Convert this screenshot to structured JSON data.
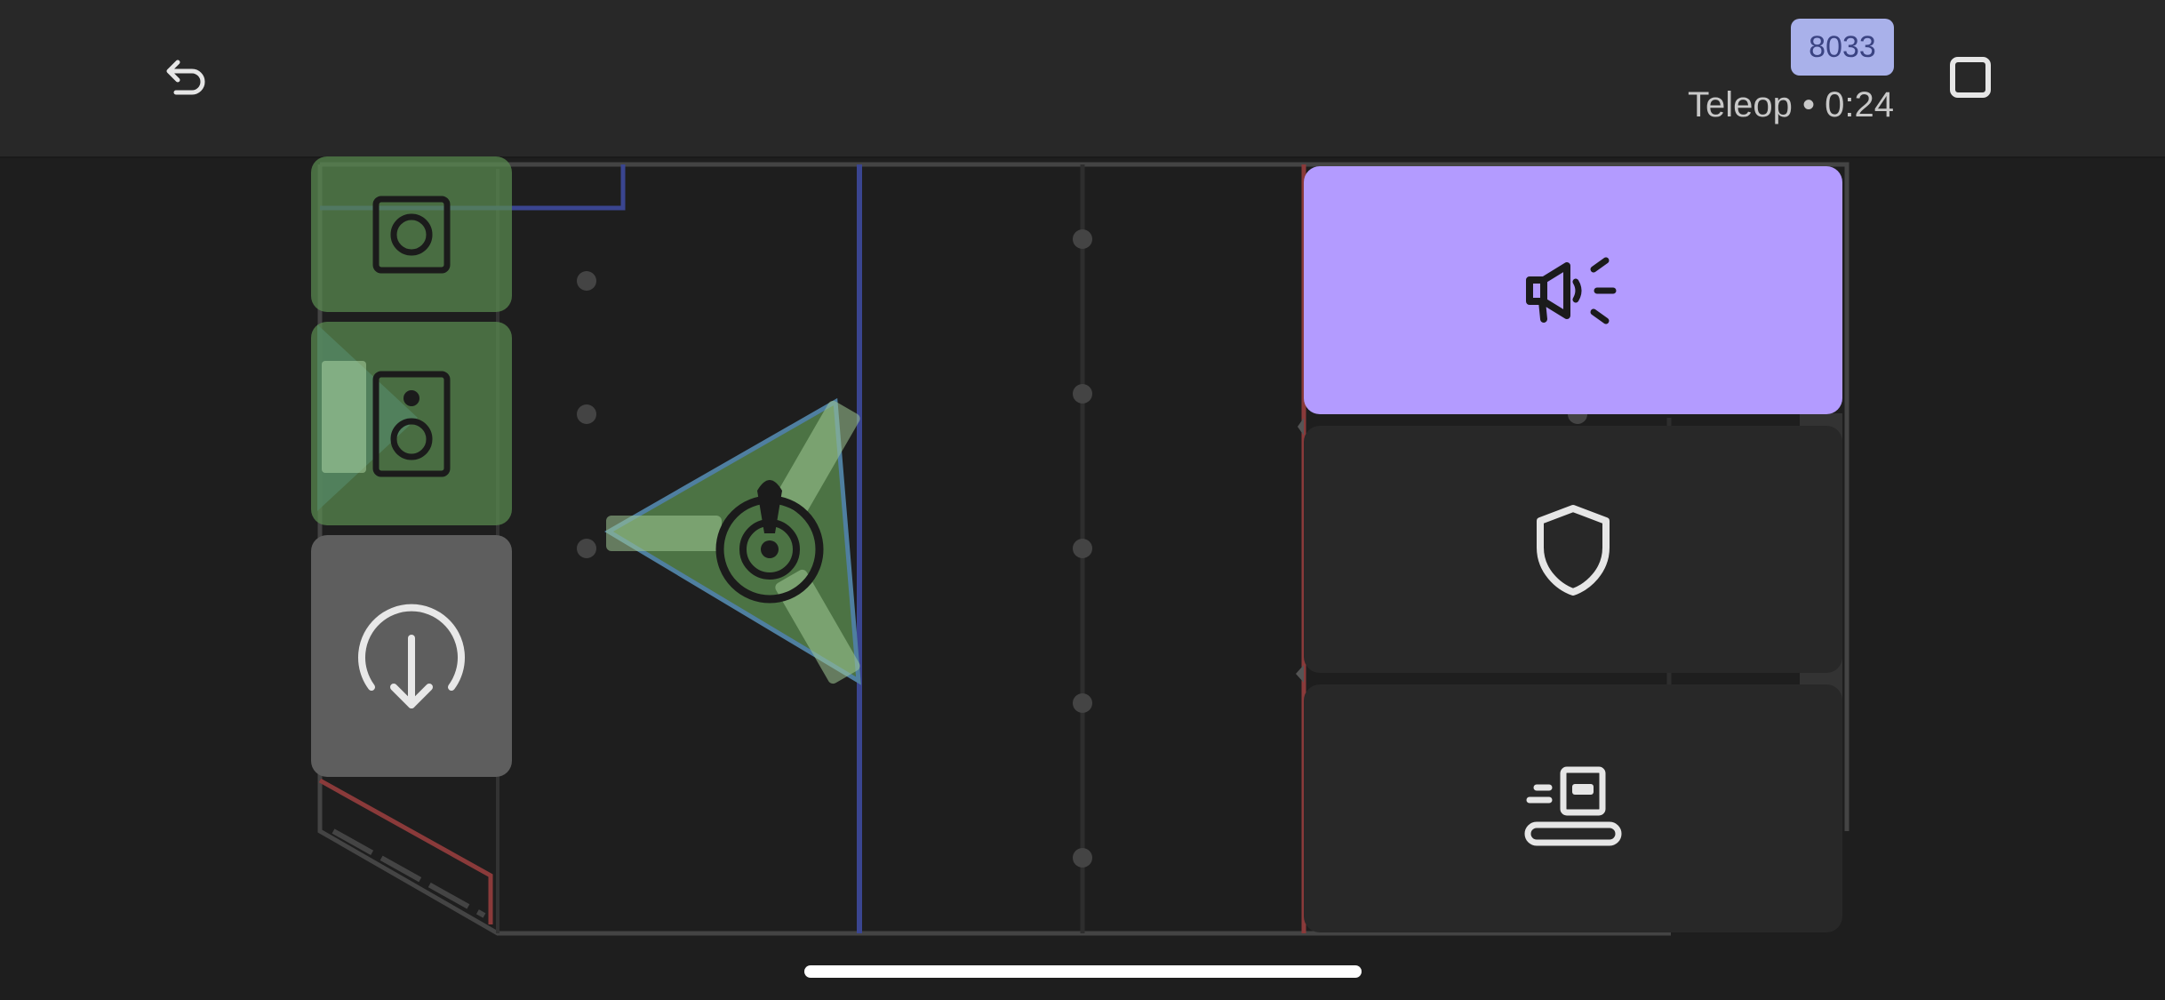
{
  "header": {
    "back_icon": "undo-arrow-icon",
    "team_number": "8033",
    "match_status": "Teleop • 0:24",
    "stop_icon": "stop-square-icon"
  },
  "field": {
    "left_tiles": [
      {
        "icon": "speaker-single-icon",
        "state": "selected-green"
      },
      {
        "icon": "speaker-double-icon",
        "state": "selected-green"
      },
      {
        "icon": "download-circle-icon",
        "state": "gray"
      }
    ],
    "center_marker": {
      "icon": "target-joystick-icon",
      "state": "selected-green"
    }
  },
  "actions": [
    {
      "icon": "megaphone-icon",
      "color": "#b39bff"
    },
    {
      "icon": "shield-icon",
      "color": "#282828"
    },
    {
      "icon": "desk-pass-icon",
      "color": "#282828"
    }
  ],
  "colors": {
    "accent_purple": "#b39bff",
    "badge_blue": "#a9b1ea",
    "selected_green": "#5a8c50",
    "blue_line": "#3a4590",
    "red_line": "#8a3a3a"
  }
}
